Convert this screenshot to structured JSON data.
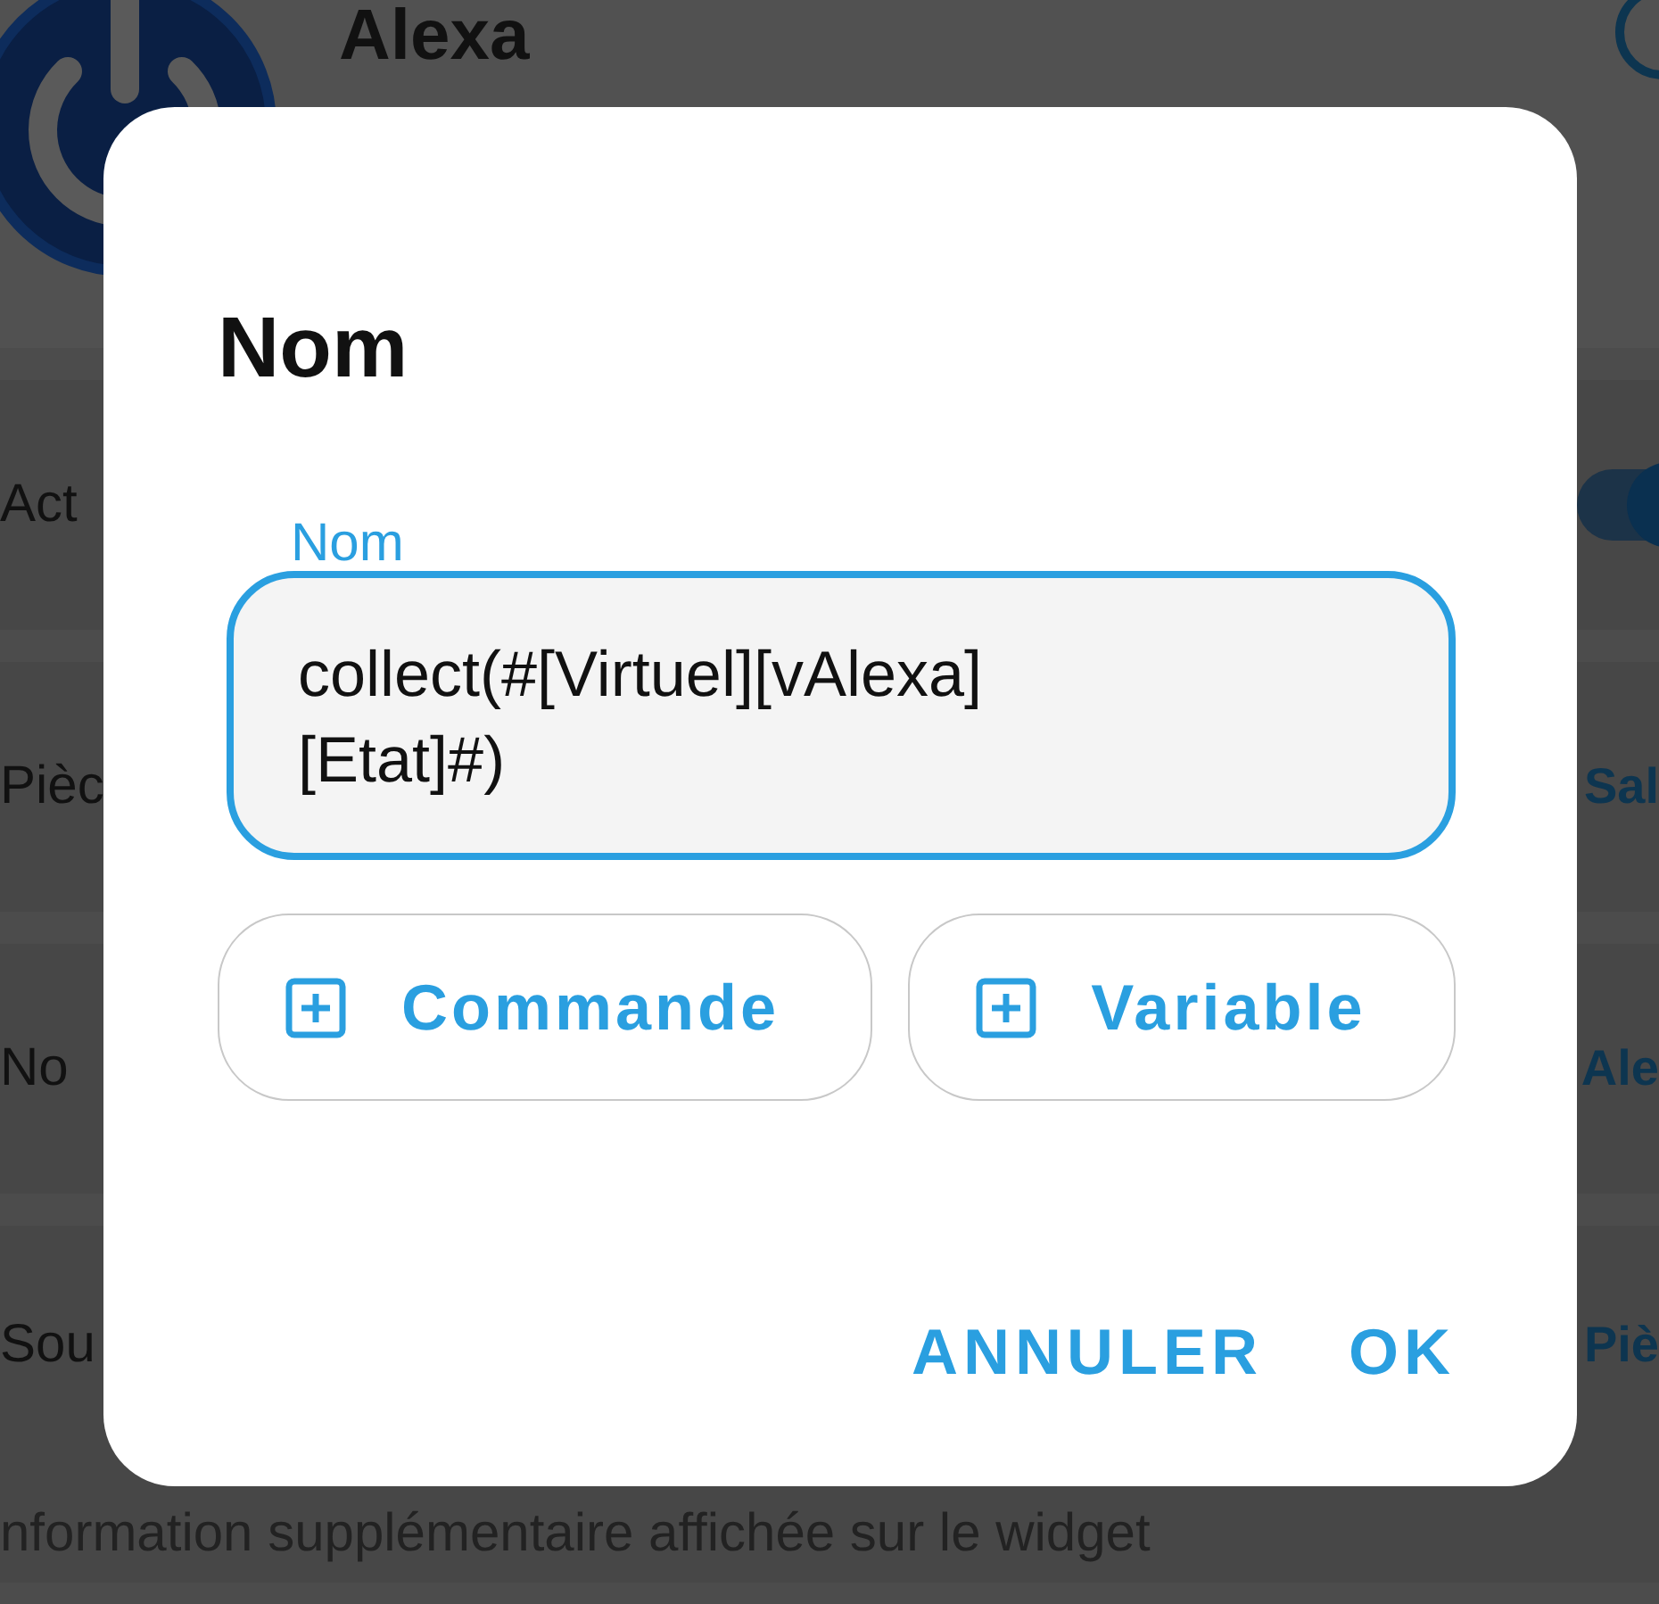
{
  "header": {
    "title": "Alexa"
  },
  "rows": [
    {
      "label": "Act",
      "kind": "toggle",
      "on": true
    },
    {
      "label": "Pièc",
      "kind": "value",
      "value": "Sal"
    },
    {
      "label": "No",
      "kind": "value",
      "value": "Ale"
    },
    {
      "label": "Sou",
      "kind": "value",
      "value": "Piè",
      "description": "nformation supplémentaire affichée sur le widget"
    }
  ],
  "dialog": {
    "title": "Nom",
    "field": {
      "label": "Nom",
      "value": "collect(#[Virtuel][vAlexa][Etat]#)",
      "focused": true
    },
    "insert_buttons": [
      "Commande",
      "Variable"
    ],
    "actions": [
      "ANNULER",
      "OK"
    ]
  }
}
